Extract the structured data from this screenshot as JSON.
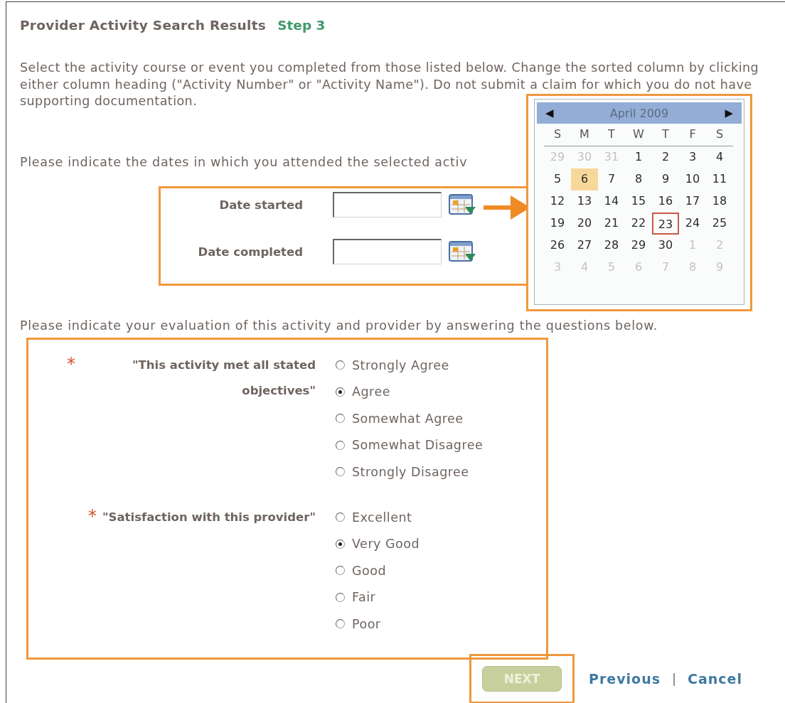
{
  "title": "Provider Activity Search Results",
  "step": "Step 3",
  "intro": "Select the activity course or event you completed from those listed below. Change the sorted column by clicking either column heading (\"Activity Number\" or \"Activity Name\"). Do not submit a claim for which you do not have supporting documentation.",
  "dates_prompt": "Please indicate the dates in which you attended the selected activ",
  "date_fields": [
    {
      "label": "Date started"
    },
    {
      "label": "Date completed"
    }
  ],
  "calendar": {
    "prev": "◀",
    "month": "April 2009",
    "next": "▶",
    "weekdays": [
      "S",
      "M",
      "T",
      "W",
      "T",
      "F",
      "S"
    ],
    "weeks": [
      [
        {
          "d": "29",
          "muted": true,
          "highlighted": false,
          "selected": false
        },
        {
          "d": "30",
          "muted": true,
          "highlighted": false,
          "selected": false
        },
        {
          "d": "31",
          "muted": true,
          "highlighted": false,
          "selected": false
        },
        {
          "d": "1",
          "muted": false,
          "highlighted": false,
          "selected": false
        },
        {
          "d": "2",
          "muted": false,
          "highlighted": false,
          "selected": false
        },
        {
          "d": "3",
          "muted": false,
          "highlighted": false,
          "selected": false
        },
        {
          "d": "4",
          "muted": false,
          "highlighted": false,
          "selected": false
        }
      ],
      [
        {
          "d": "5",
          "muted": false,
          "highlighted": false,
          "selected": false
        },
        {
          "d": "6",
          "muted": false,
          "highlighted": true,
          "selected": false
        },
        {
          "d": "7",
          "muted": false,
          "highlighted": false,
          "selected": false
        },
        {
          "d": "8",
          "muted": false,
          "highlighted": false,
          "selected": false
        },
        {
          "d": "9",
          "muted": false,
          "highlighted": false,
          "selected": false
        },
        {
          "d": "10",
          "muted": false,
          "highlighted": false,
          "selected": false
        },
        {
          "d": "11",
          "muted": false,
          "highlighted": false,
          "selected": false
        }
      ],
      [
        {
          "d": "12",
          "muted": false,
          "highlighted": false,
          "selected": false
        },
        {
          "d": "13",
          "muted": false,
          "highlighted": false,
          "selected": false
        },
        {
          "d": "14",
          "muted": false,
          "highlighted": false,
          "selected": false
        },
        {
          "d": "15",
          "muted": false,
          "highlighted": false,
          "selected": false
        },
        {
          "d": "16",
          "muted": false,
          "highlighted": false,
          "selected": false
        },
        {
          "d": "17",
          "muted": false,
          "highlighted": false,
          "selected": false
        },
        {
          "d": "18",
          "muted": false,
          "highlighted": false,
          "selected": false
        }
      ],
      [
        {
          "d": "19",
          "muted": false,
          "highlighted": false,
          "selected": false
        },
        {
          "d": "20",
          "muted": false,
          "highlighted": false,
          "selected": false
        },
        {
          "d": "21",
          "muted": false,
          "highlighted": false,
          "selected": false
        },
        {
          "d": "22",
          "muted": false,
          "highlighted": false,
          "selected": false
        },
        {
          "d": "23",
          "muted": false,
          "highlighted": false,
          "selected": true
        },
        {
          "d": "24",
          "muted": false,
          "highlighted": false,
          "selected": false
        },
        {
          "d": "25",
          "muted": false,
          "highlighted": false,
          "selected": false
        }
      ],
      [
        {
          "d": "26",
          "muted": false,
          "highlighted": false,
          "selected": false
        },
        {
          "d": "27",
          "muted": false,
          "highlighted": false,
          "selected": false
        },
        {
          "d": "28",
          "muted": false,
          "highlighted": false,
          "selected": false
        },
        {
          "d": "29",
          "muted": false,
          "highlighted": false,
          "selected": false
        },
        {
          "d": "30",
          "muted": false,
          "highlighted": false,
          "selected": false
        },
        {
          "d": "1",
          "muted": true,
          "highlighted": false,
          "selected": false
        },
        {
          "d": "2",
          "muted": true,
          "highlighted": false,
          "selected": false
        }
      ],
      [
        {
          "d": "3",
          "muted": true,
          "highlighted": false,
          "selected": false
        },
        {
          "d": "4",
          "muted": true,
          "highlighted": false,
          "selected": false
        },
        {
          "d": "5",
          "muted": true,
          "highlighted": false,
          "selected": false
        },
        {
          "d": "6",
          "muted": true,
          "highlighted": false,
          "selected": false
        },
        {
          "d": "7",
          "muted": true,
          "highlighted": false,
          "selected": false
        },
        {
          "d": "8",
          "muted": true,
          "highlighted": false,
          "selected": false
        },
        {
          "d": "9",
          "muted": true,
          "highlighted": false,
          "selected": false
        }
      ]
    ]
  },
  "eval_prompt": "Please indicate your evaluation of this activity and provider by answering the questions below.",
  "questions": [
    {
      "required_mark": "*",
      "label": "\"This activity met all stated objectives\"",
      "options": [
        {
          "label": "Strongly Agree",
          "selected": false
        },
        {
          "label": "Agree",
          "selected": true
        },
        {
          "label": "Somewhat Agree",
          "selected": false
        },
        {
          "label": "Somewhat Disagree",
          "selected": false
        },
        {
          "label": "Strongly Disagree",
          "selected": false
        }
      ]
    },
    {
      "required_mark": "*",
      "label": "\"Satisfaction with this provider\"",
      "options": [
        {
          "label": "Excellent",
          "selected": false
        },
        {
          "label": "Very Good",
          "selected": true
        },
        {
          "label": "Good",
          "selected": false
        },
        {
          "label": "Fair",
          "selected": false
        },
        {
          "label": "Poor",
          "selected": false
        }
      ]
    }
  ],
  "next_button": {
    "label": "NEXT",
    "disabled": true
  },
  "links": [
    "Previous",
    "Cancel"
  ],
  "link_separator": "|"
}
